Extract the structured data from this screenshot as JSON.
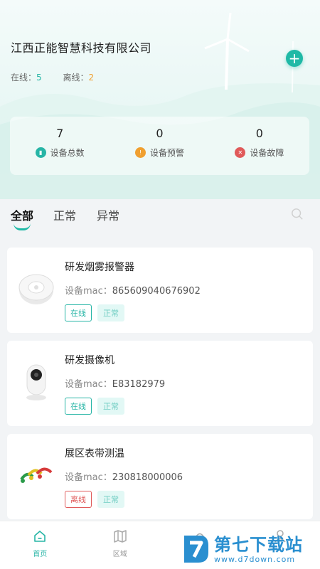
{
  "header": {
    "company": "江西正能智慧科技有限公司",
    "online_label": "在线：",
    "online_count": "5",
    "offline_label": "离线：",
    "offline_count": "2",
    "add_icon": "plus-icon"
  },
  "stats": [
    {
      "value": "7",
      "label": "设备总数",
      "icon": "device-icon",
      "color": "#27b5a6"
    },
    {
      "value": "0",
      "label": "设备预警",
      "icon": "warning-icon",
      "color": "#f0a030"
    },
    {
      "value": "0",
      "label": "设备故障",
      "icon": "fault-icon",
      "color": "#e05a5a"
    }
  ],
  "tabs": [
    "全部",
    "正常",
    "异常"
  ],
  "active_tab": "全部",
  "devices": [
    {
      "name": "研发烟雾报警器",
      "mac_label": "设备mac：",
      "mac": "865609040676902",
      "status": "在线",
      "state": "正常",
      "image": "smoke-detector"
    },
    {
      "name": "研发摄像机",
      "mac_label": "设备mac：",
      "mac": "E83182979",
      "status": "在线",
      "state": "正常",
      "image": "camera"
    },
    {
      "name": "展区表带测温",
      "mac_label": "设备mac：",
      "mac": "230818000006",
      "status": "离线",
      "state": "正常",
      "image": "temperature-bands"
    }
  ],
  "nav": [
    {
      "label": "首页",
      "icon": "home-icon"
    },
    {
      "label": "区域",
      "icon": "map-icon"
    },
    {
      "label": "",
      "icon": "alarm-icon"
    },
    {
      "label": "",
      "icon": "user-icon"
    }
  ],
  "watermark": {
    "title": "第七下载站",
    "url": "www.d7down.com"
  },
  "colors": {
    "accent": "#1fb9a6",
    "online": "#27b5a6",
    "offline": "#e05a5a",
    "warning": "#f0a030"
  }
}
